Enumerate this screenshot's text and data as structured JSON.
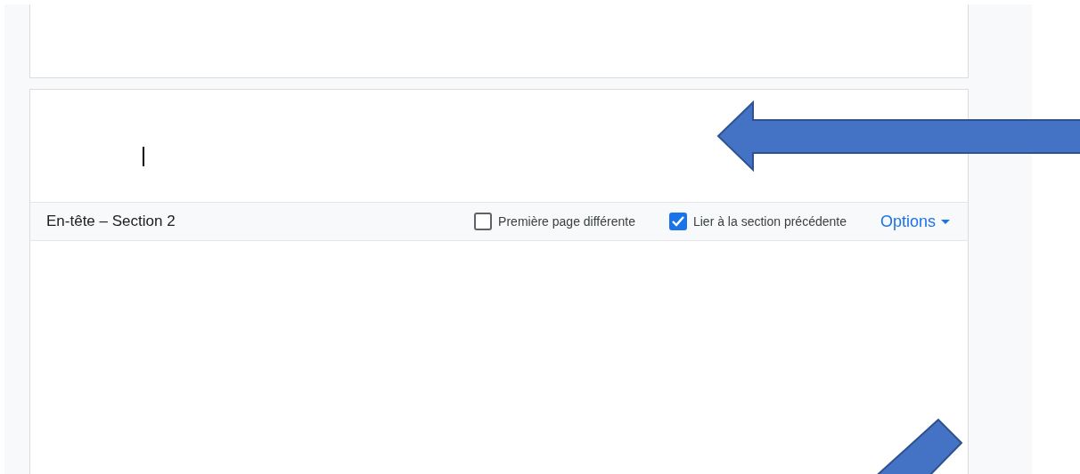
{
  "header_bar": {
    "title": "En-tête – Section 2",
    "checkboxes": [
      {
        "label": "Première page différente",
        "checked": false
      },
      {
        "label": "Lier à la section précédente",
        "checked": true
      }
    ],
    "options_button": {
      "label": "Options"
    }
  }
}
